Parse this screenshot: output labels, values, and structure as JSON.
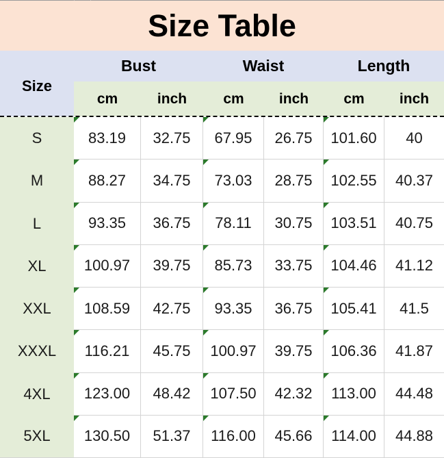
{
  "title": "Size Table",
  "header": {
    "size_label": "Size",
    "groups": [
      {
        "name": "Bust",
        "units": [
          "cm",
          "inch"
        ]
      },
      {
        "name": "Waist",
        "units": [
          "cm",
          "inch"
        ]
      },
      {
        "name": "Length",
        "units": [
          "cm",
          "inch"
        ]
      }
    ]
  },
  "colors": {
    "title_band": "#FCE3D3",
    "header_band": "#DCE1F1",
    "subheader_band": "#E4EDD8",
    "size_column": "#E4EDD8",
    "grid_line": "#D4D4D4",
    "corner_flag": "#2B7A2B",
    "text": "#1A1A1A"
  },
  "columns": [
    "Size",
    "Bust cm",
    "Bust inch",
    "Waist cm",
    "Waist inch",
    "Length cm",
    "Length inch"
  ],
  "rows": [
    {
      "size": "S",
      "bust_cm": "83.19",
      "bust_inch": "32.75",
      "waist_cm": "67.95",
      "waist_inch": "26.75",
      "length_cm": "101.60",
      "length_inch": "40"
    },
    {
      "size": "M",
      "bust_cm": "88.27",
      "bust_inch": "34.75",
      "waist_cm": "73.03",
      "waist_inch": "28.75",
      "length_cm": "102.55",
      "length_inch": "40.37"
    },
    {
      "size": "L",
      "bust_cm": "93.35",
      "bust_inch": "36.75",
      "waist_cm": "78.11",
      "waist_inch": "30.75",
      "length_cm": "103.51",
      "length_inch": "40.75"
    },
    {
      "size": "XL",
      "bust_cm": "100.97",
      "bust_inch": "39.75",
      "waist_cm": "85.73",
      "waist_inch": "33.75",
      "length_cm": "104.46",
      "length_inch": "41.12"
    },
    {
      "size": "XXL",
      "bust_cm": "108.59",
      "bust_inch": "42.75",
      "waist_cm": "93.35",
      "waist_inch": "36.75",
      "length_cm": "105.41",
      "length_inch": "41.5"
    },
    {
      "size": "XXXL",
      "bust_cm": "116.21",
      "bust_inch": "45.75",
      "waist_cm": "100.97",
      "waist_inch": "39.75",
      "length_cm": "106.36",
      "length_inch": "41.87"
    },
    {
      "size": "4XL",
      "bust_cm": "123.00",
      "bust_inch": "48.42",
      "waist_cm": "107.50",
      "waist_inch": "42.32",
      "length_cm": "113.00",
      "length_inch": "44.48"
    },
    {
      "size": "5XL",
      "bust_cm": "130.50",
      "bust_inch": "51.37",
      "waist_cm": "116.00",
      "waist_inch": "45.66",
      "length_cm": "114.00",
      "length_inch": "44.88"
    }
  ]
}
